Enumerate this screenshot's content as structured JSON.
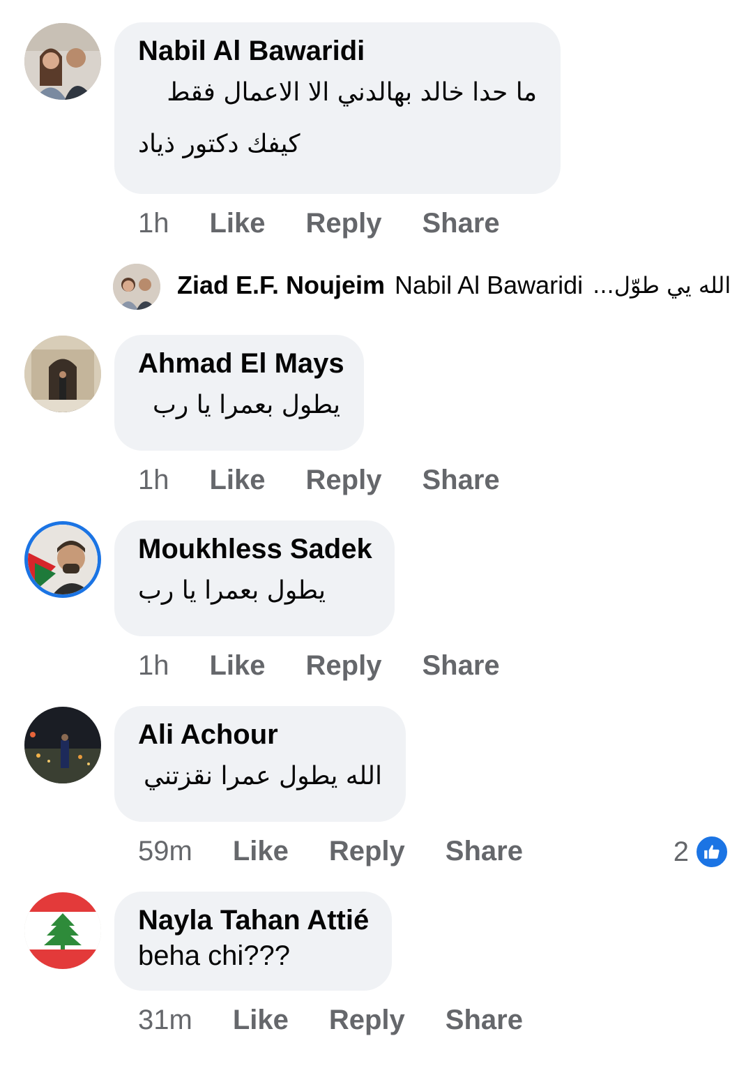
{
  "colors": {
    "bubble": "#f0f2f5",
    "meta": "#65676b",
    "accent": "#1b74e4"
  },
  "actions": {
    "like": "Like",
    "reply": "Reply",
    "share": "Share"
  },
  "comments": [
    {
      "author": "Nabil Al Bawaridi",
      "lines": [
        "ما حدا خالد بهالدني الا الاعمال فقط",
        "كيفك دكتور ذياد"
      ],
      "time": "1h",
      "avatar_icon": "couple-photo"
    },
    {
      "author": "Ahmad El Mays",
      "lines": [
        "يطول بعمرا يا رب"
      ],
      "time": "1h",
      "avatar_icon": "archway-photo"
    },
    {
      "author": "Moukhless Sadek",
      "lines": [
        "يطول بعمرا يا رب"
      ],
      "time": "1h",
      "avatar_icon": "man-flag-photo"
    },
    {
      "author": "Ali Achour",
      "lines": [
        "الله يطول عمرا نقزتني"
      ],
      "time": "59m",
      "avatar_icon": "city-night-photo"
    },
    {
      "author": "Nayla Tahan Attié",
      "lines": [
        "beha chi???"
      ],
      "time": "31m",
      "avatar_icon": "lebanon-flag"
    }
  ],
  "reply": {
    "author": "Ziad E.F. Noujeim",
    "mention": "Nabil Al Bawaridi",
    "text": "الله يي طوّل..."
  },
  "reaction": {
    "count": "2",
    "icon": "thumbs-up-icon"
  }
}
